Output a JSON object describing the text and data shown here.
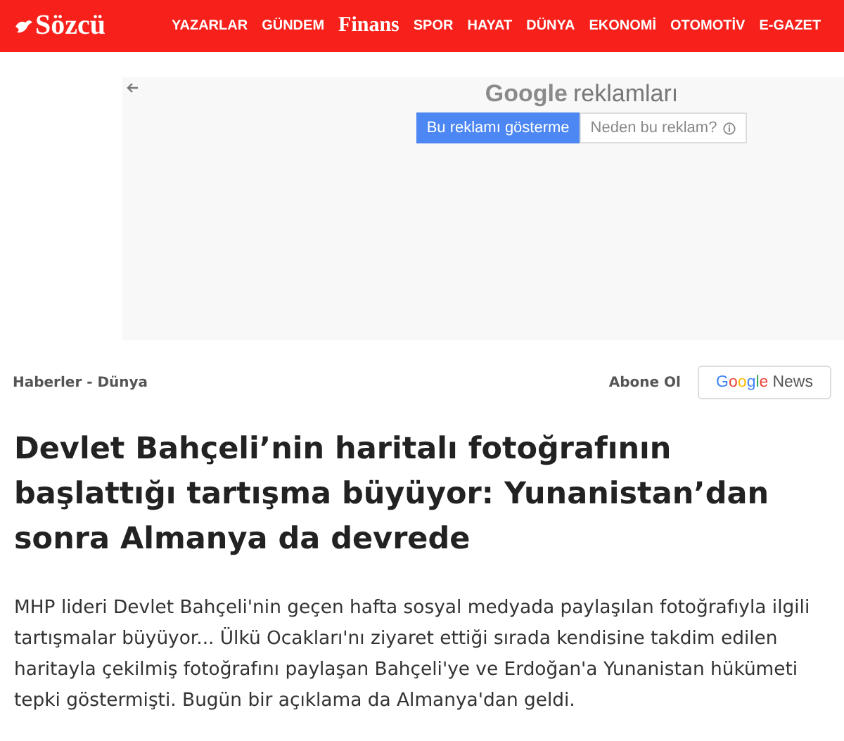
{
  "header": {
    "logo": "Sözcü",
    "nav": [
      {
        "label": "YAZARLAR",
        "kind": "plain"
      },
      {
        "label": "GÜNDEM",
        "kind": "plain"
      },
      {
        "label": "Finans",
        "kind": "serif"
      },
      {
        "label": "SPOR",
        "kind": "plain"
      },
      {
        "label": "HAYAT",
        "kind": "plain"
      },
      {
        "label": "DÜNYA",
        "kind": "plain"
      },
      {
        "label": "EKONOMİ",
        "kind": "plain"
      },
      {
        "label": "OTOMOTİV",
        "kind": "plain"
      },
      {
        "label": "E-GAZET",
        "kind": "plain"
      }
    ]
  },
  "ad": {
    "brand": "Google",
    "title": "reklamları",
    "hide_button": "Bu reklamı gösterme",
    "why_button": "Neden bu reklam?"
  },
  "breadcrumb": "Haberler - Dünya",
  "subscribe": {
    "label": "Abone Ol",
    "brand": "Google",
    "service": "News"
  },
  "headline": "Devlet Bahçeli’nin haritalı fotoğrafının başlattığı tartışma büyüyor: Yunanistan’dan sonra Almanya da devrede",
  "lead": "MHP lideri Devlet Bahçeli'nin geçen hafta sosyal medyada paylaşılan fotoğrafıyla ilgili tartışmalar büyüyor... Ülkü Ocakları'nı ziyaret ettiği sırada kendisine takdim edilen haritayla çekilmiş fotoğrafını paylaşan Bahçeli'ye ve Erdoğan'a Yunanistan hükümeti tepki göstermişti. Bugün bir açıklama da Almanya'dan geldi."
}
